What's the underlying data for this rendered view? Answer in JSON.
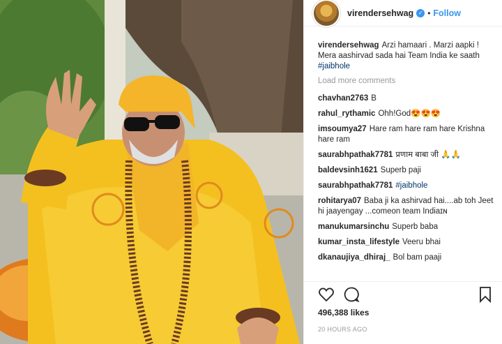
{
  "post": {
    "image_alt": "Man in saffron robes, sunglasses and rudraksha beads waving",
    "handle": "virendersehwag",
    "follow_label": "Follow",
    "separator": "•",
    "caption": {
      "user": "virendersehwag",
      "text": "Arzi hamaari . Marzi aapki ! Mera aashirvad sada hai Team India ke saath ",
      "hashtag": "#jaibhole"
    },
    "load_more": "Load more comments",
    "comments": [
      {
        "user": "chavhan2763",
        "text": "B"
      },
      {
        "user": "rahul_rythamic",
        "text": "Ohh!God😍😍😍"
      },
      {
        "user": "imsoumya27",
        "text": "Hare ram hare ram hare Krishna hare ram"
      },
      {
        "user": "saurabhpathak7781",
        "text": "प्रणाम बाबा जी 🙏🙏"
      },
      {
        "user": "baldevsinh1621",
        "text": "Superb paji"
      },
      {
        "user": "saurabhpathak7781",
        "text": "",
        "hashtag": "#jaibhole"
      },
      {
        "user": "rohitarya07",
        "text": "Baba ji ka ashirvad hai....ab toh Jeet hi jaayengay ...comeon team Indiaɪɴ"
      },
      {
        "user": "manukumarsinchu",
        "text": "Superb baba"
      },
      {
        "user": "kumar_insta_lifestyle",
        "text": "Veeru bhai"
      },
      {
        "user": "dkanaujiya_dhiraj_",
        "text": "Bol bam paaji"
      }
    ],
    "likes": "496,388 likes",
    "timestamp": "20 HOURS AGO",
    "icons": [
      "heart-icon",
      "comment-icon",
      "bookmark-icon"
    ],
    "colors": {
      "link": "#3897f0",
      "hashtag": "#003569",
      "robe": "#f5c518"
    }
  }
}
